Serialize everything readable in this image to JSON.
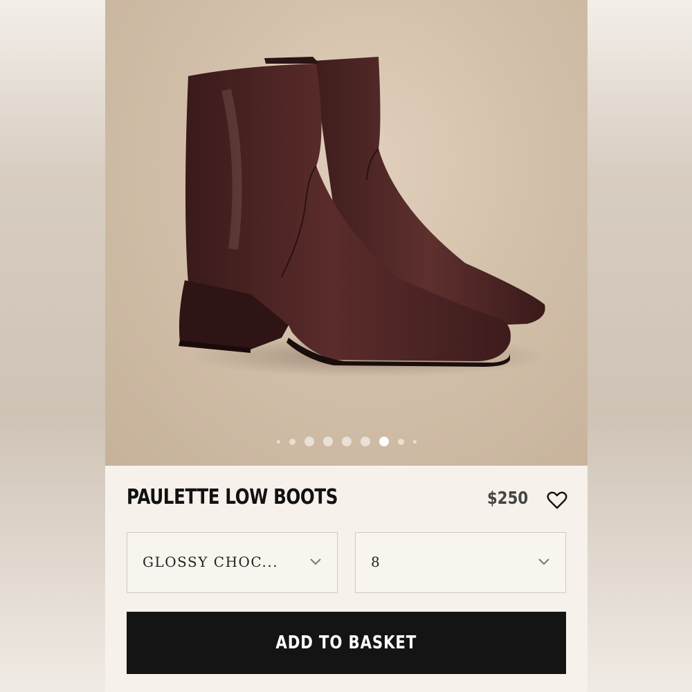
{
  "product": {
    "name": "PAULETTE LOW BOOTS",
    "price": "$250"
  },
  "gallery": {
    "image_icon": "ankle-boots-photo",
    "slide_count": 8,
    "active_slide": 6
  },
  "options": {
    "color_value": "GLOSSY CHOC...",
    "size_value": "8"
  },
  "actions": {
    "add_to_basket_label": "ADD TO BASKET",
    "wishlist_icon": "heart-icon"
  },
  "colors": {
    "button_bg": "#141414",
    "page_bg": "#f6f2eb",
    "boot_leather": "#4a2424"
  }
}
